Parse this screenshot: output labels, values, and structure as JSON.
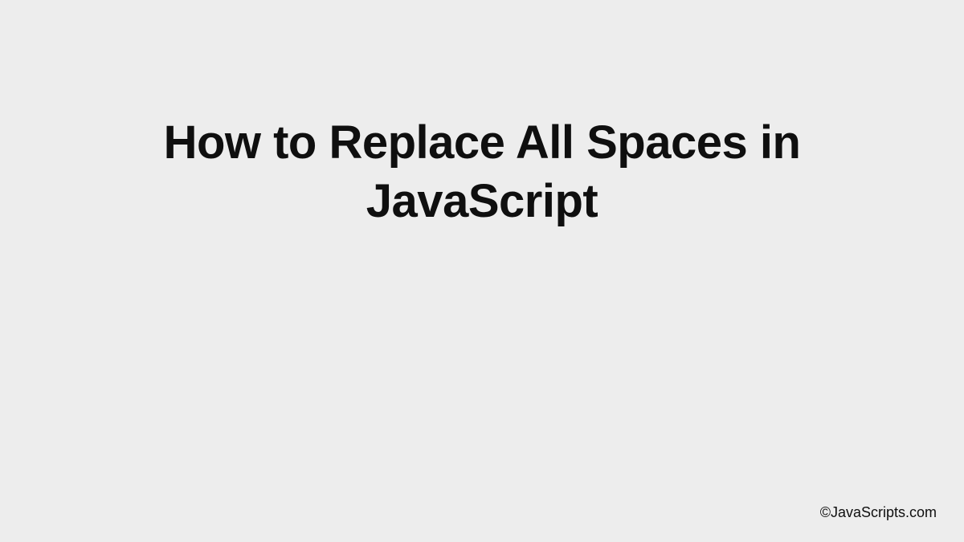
{
  "title": "How to Replace All Spaces in JavaScript",
  "attribution": "©JavaScripts.com"
}
